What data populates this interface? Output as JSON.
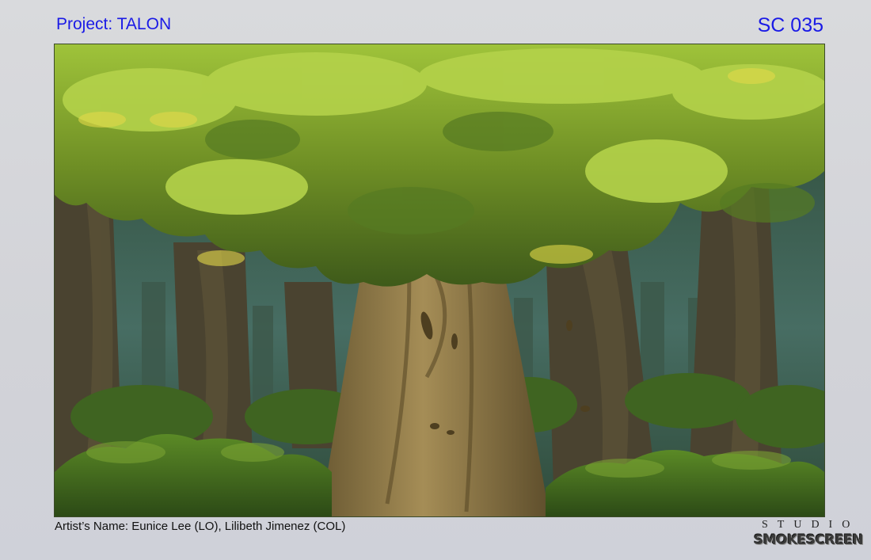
{
  "header": {
    "project": "Project: TALON",
    "scene": "SC 035"
  },
  "footer": {
    "artists": "Artist’s Name: Eunice Lee (LO), Lilibeth Jimenez (COL)",
    "studio_top": "STUDIO",
    "studio_name": "SMOKESCREEN"
  },
  "colors": {
    "title_text": "#1a1ae6",
    "canopy_light": "#a9c93a",
    "canopy_dark": "#4f6b1e",
    "trunk": "#8a7546",
    "background_forest": "#2d4a3c"
  }
}
